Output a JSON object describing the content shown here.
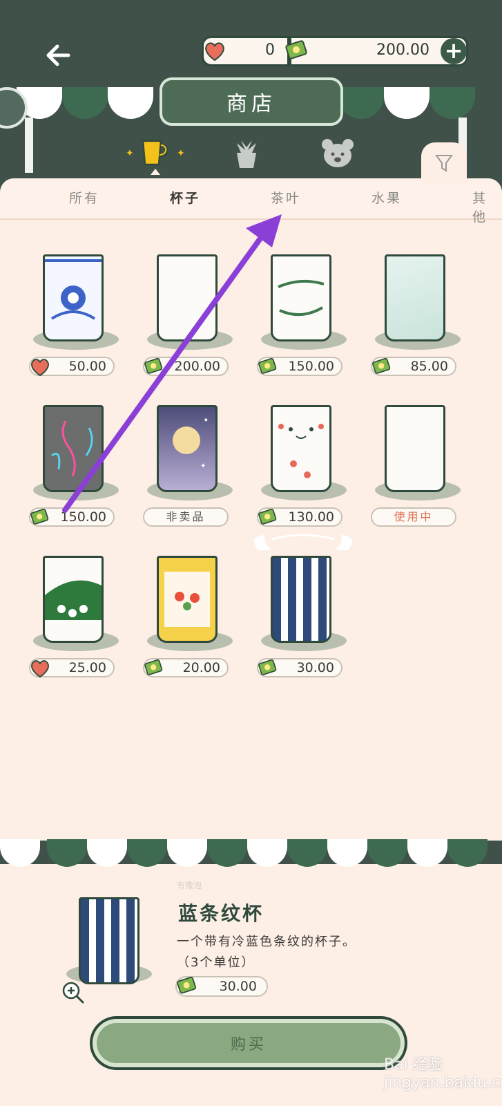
{
  "header": {
    "back_icon": "arrow-left-icon",
    "hearts": "0",
    "money": "200.00",
    "title": "商店"
  },
  "categories": [
    {
      "name": "cup",
      "icon": "cup-icon",
      "active": true
    },
    {
      "name": "plant",
      "icon": "plant-icon",
      "active": false
    },
    {
      "name": "bear",
      "icon": "bear-icon",
      "active": false
    }
  ],
  "tabs": [
    "所有",
    "杯子",
    "茶叶",
    "水果",
    "其他"
  ],
  "active_tab": "杯子",
  "items": [
    {
      "price": "50.00",
      "currency": "heart"
    },
    {
      "price": "200.00",
      "currency": "money"
    },
    {
      "price": "150.00",
      "currency": "money"
    },
    {
      "price": "85.00",
      "currency": "money"
    },
    {
      "price": "150.00",
      "currency": "money"
    },
    {
      "price": "非卖品",
      "currency": "none"
    },
    {
      "price": "130.00",
      "currency": "money"
    },
    {
      "price": "使用中",
      "currency": "none"
    },
    {
      "price": "25.00",
      "currency": "heart"
    },
    {
      "price": "20.00",
      "currency": "money"
    },
    {
      "price": "30.00",
      "currency": "money"
    }
  ],
  "detail": {
    "badge": "有撒泡",
    "name": "蓝条纹杯",
    "description": "一个带有冷蓝色条纹的杯子。",
    "units": "（3个单位）",
    "price": "30.00"
  },
  "buy_label": "购买",
  "watermark": "Bai 经验 jingyan.baidu.com",
  "colors": {
    "dark_green": "#2f4a3c",
    "panel": "#fdeee6",
    "button": "#8aa882",
    "arrow": "#8a3fd6"
  }
}
